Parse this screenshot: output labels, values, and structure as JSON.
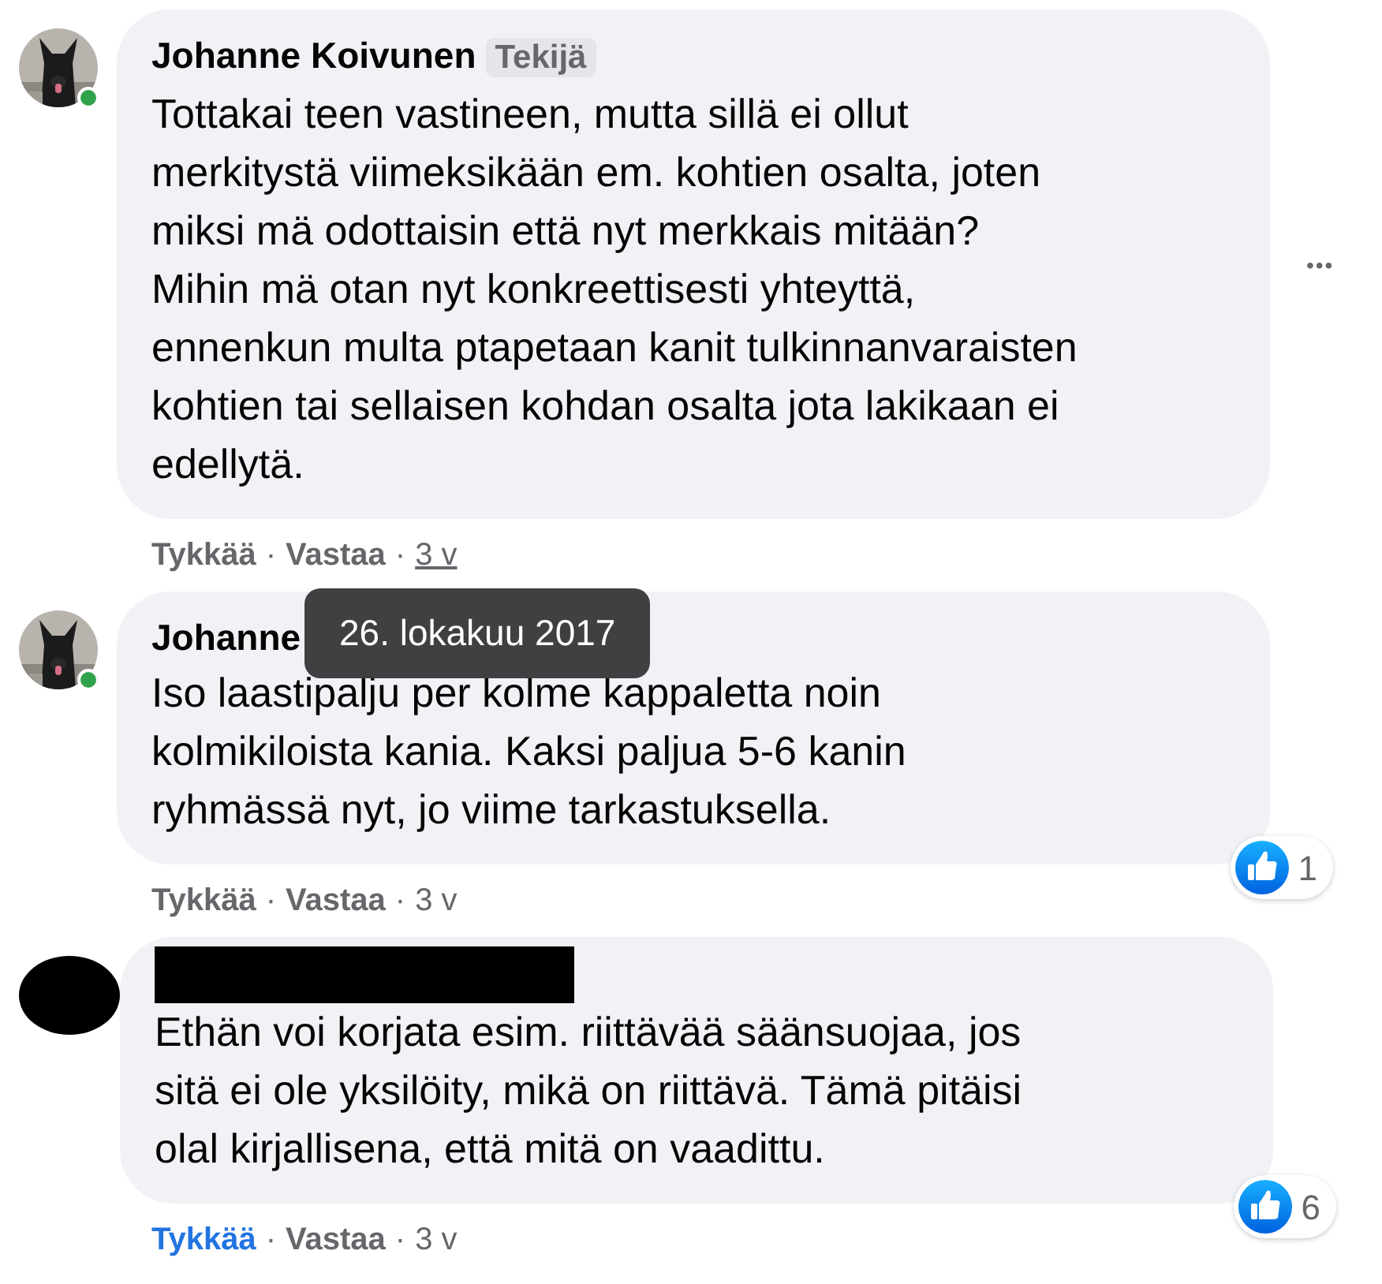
{
  "comments": [
    {
      "online": true,
      "name": "Johanne Koivunen",
      "redacted": false,
      "badge": "Tekijä",
      "lines": [
        "Tottakai teen vastineen, mutta sillä ei ollut",
        "merkitystä viimeksikään em. kohtien osalta, joten",
        "miksi mä odottaisin että nyt merkkais mitään?",
        "Mihin mä otan nyt konkreettisesti yhteyttä,",
        "ennenkun multa ptapetaan kanit tulkinnanvaraisten",
        "kohtien tai sellaisen kohdan osalta jota lakikaan ei",
        "edellytä."
      ],
      "more_menu": "•••",
      "like": "Tykkää",
      "liked": false,
      "separator": "·",
      "reply": "Vastaa",
      "time": "3 v",
      "time_hovered": true,
      "tooltip": "26. lokakuu 2017"
    },
    {
      "online": true,
      "name": "Johanne",
      "redacted": false,
      "lines": [
        "Iso laastipalju per kolme kappaletta noin",
        "kolmikiloista kania. Kaksi paljua 5-6 kanin",
        "ryhmässä nyt, jo viime tarkastuksella."
      ],
      "reactions": "1",
      "like": "Tykkää",
      "liked": false,
      "separator": "·",
      "reply": "Vastaa",
      "time": "3 v",
      "time_hovered": false
    },
    {
      "online": false,
      "redacted": true,
      "lines": [
        "Ethän voi korjata esim. riittävää säänsuojaa, jos",
        "sitä ei ole yksilöity, mikä on riittävä. Tämä pitäisi",
        "olal kirjallisena, että mitä on vaadittu."
      ],
      "reactions": "6",
      "like": "Tykkää",
      "liked": true,
      "separator": "·",
      "reply": "Vastaa",
      "time": "3 v",
      "time_hovered": false
    }
  ]
}
